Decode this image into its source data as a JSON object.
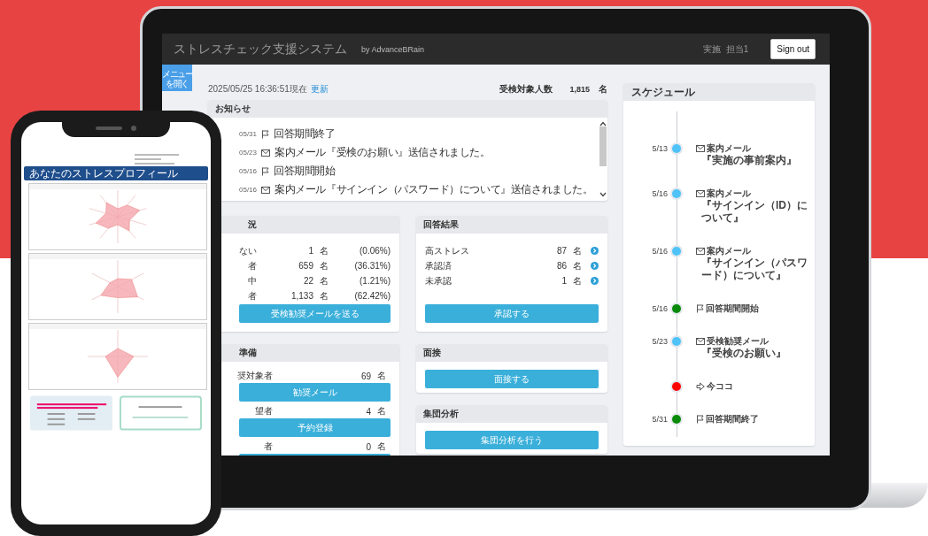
{
  "app": {
    "title": "ストレスチェック支援システム",
    "byline": "by AdvanceBRain",
    "user_role": "実施",
    "user_name": "担当1",
    "sign_out": "Sign out",
    "menu_button": "メニューを開く"
  },
  "summary": {
    "timestamp": "2025/05/25 16:36:51現在",
    "refresh_link": "更新",
    "target_label": "受検対象人数",
    "target_count": "1,815",
    "target_unit": "名"
  },
  "notices": {
    "title": "お知らせ",
    "items": [
      {
        "date": "05/31",
        "kind": "flag",
        "text": "回答期間終了"
      },
      {
        "date": "05/23",
        "kind": "mail",
        "text": "案内メール『受検のお願い』送信されました。"
      },
      {
        "date": "05/16",
        "kind": "flag",
        "text": "回答期間開始"
      },
      {
        "date": "05/16",
        "kind": "mail",
        "text": "案内メール『サインイン（パスワード）について』送信されました。"
      }
    ]
  },
  "status_panel": {
    "title": "況",
    "rows": [
      {
        "label": "ない",
        "count": "1",
        "unit": "名",
        "percent": "(0.06%)"
      },
      {
        "label": "者",
        "count": "659",
        "unit": "名",
        "percent": "(36.31%)"
      },
      {
        "label": "中",
        "count": "22",
        "unit": "名",
        "percent": "(1.21%)"
      },
      {
        "label": "者",
        "count": "1,133",
        "unit": "名",
        "percent": "(62.42%)"
      }
    ],
    "button": "受検勧奨メールを送る"
  },
  "results_panel": {
    "title": "回答結果",
    "rows": [
      {
        "label": "高ストレス",
        "count": "87",
        "unit": "名"
      },
      {
        "label": "承認済",
        "count": "86",
        "unit": "名"
      },
      {
        "label": "未承認",
        "count": "1",
        "unit": "名"
      }
    ],
    "button": "承認する"
  },
  "prep_panel": {
    "title": "準備",
    "rows": [
      {
        "label": "奨対象者",
        "count": "69",
        "unit": "名",
        "button": "勧奨メール"
      },
      {
        "label": "望者",
        "count": "4",
        "unit": "名",
        "button": "予約登録"
      },
      {
        "label": "者",
        "count": "0",
        "unit": "名",
        "cut_button": true
      }
    ]
  },
  "interview_panel": {
    "title": "面接",
    "button": "面接する"
  },
  "analysis_panel": {
    "title": "集団分析",
    "button": "集団分析を行う"
  },
  "schedule": {
    "title": "スケジュール",
    "items": [
      {
        "date": "5/13",
        "kind": "mail",
        "color": "#4fc3f7",
        "title": "案内メール",
        "detail": "『実施の事前案内』"
      },
      {
        "date": "5/16",
        "kind": "mail",
        "color": "#4fc3f7",
        "title": "案内メール",
        "detail": "『サインイン（ID）について』"
      },
      {
        "date": "5/16",
        "kind": "mail",
        "color": "#4fc3f7",
        "title": "案内メール",
        "detail": "『サインイン（パスワード）について』"
      },
      {
        "date": "5/16",
        "kind": "flag",
        "color": "#0a8a0a",
        "title": "回答期間開始"
      },
      {
        "date": "5/23",
        "kind": "mail",
        "color": "#4fc3f7",
        "title": "受検勧奨メール",
        "detail": "『受検のお願い』"
      },
      {
        "kind": "pointer",
        "color": "#ff0000",
        "title": "今ココ"
      },
      {
        "date": "5/31",
        "kind": "flag",
        "color": "#0a8a0a",
        "title": "回答期間終了"
      }
    ]
  },
  "phone": {
    "header": "あなたのストレスプロフィール"
  }
}
